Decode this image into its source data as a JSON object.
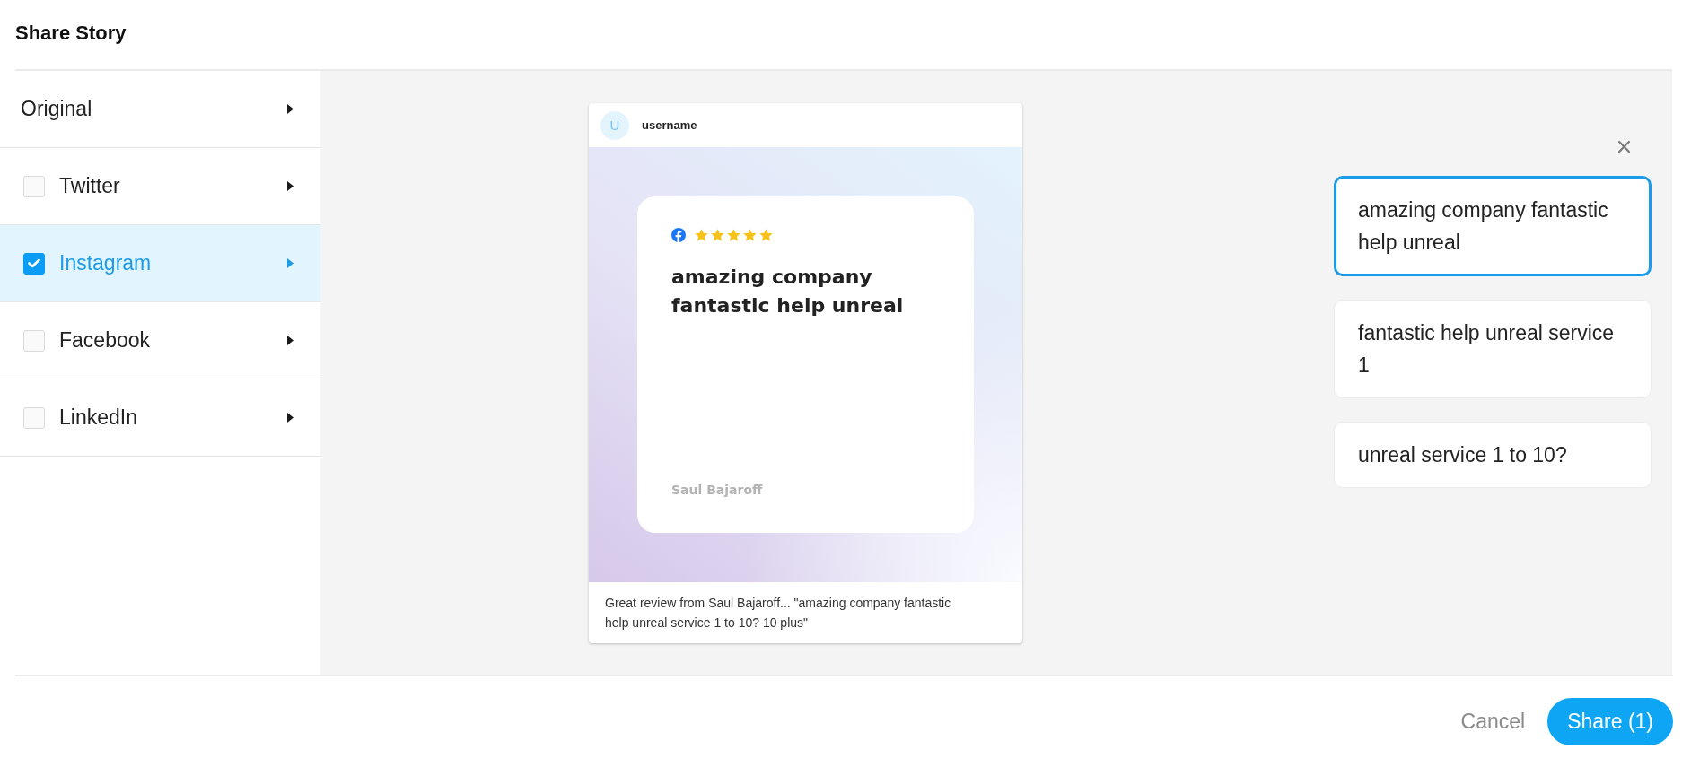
{
  "dialog": {
    "title": "Share Story"
  },
  "sidebar": {
    "items": [
      {
        "kind": "plain",
        "label": "Original",
        "selected": false
      },
      {
        "kind": "checkbox",
        "label": "Twitter",
        "checked": false,
        "selected": false
      },
      {
        "kind": "checkbox",
        "label": "Instagram",
        "checked": true,
        "selected": true
      },
      {
        "kind": "checkbox",
        "label": "Facebook",
        "checked": false,
        "selected": false
      },
      {
        "kind": "checkbox",
        "label": "LinkedIn",
        "checked": false,
        "selected": false
      }
    ]
  },
  "preview": {
    "avatar": "U",
    "username": "username",
    "stars": 5,
    "quote": "amazing company fantastic help unreal",
    "author": "Saul Bajaroff",
    "caption": "Great review from Saul Bajaroff... \"amazing company fantastic help unreal service 1 to 10? 10 plus\""
  },
  "snippets": [
    {
      "text": "amazing company fantastic help unreal",
      "selected": true
    },
    {
      "text": "fantastic help unreal service 1",
      "selected": false
    },
    {
      "text": "unreal service 1 to 10?",
      "selected": false
    }
  ],
  "footer": {
    "cancel": "Cancel",
    "share": "Share (1)"
  }
}
